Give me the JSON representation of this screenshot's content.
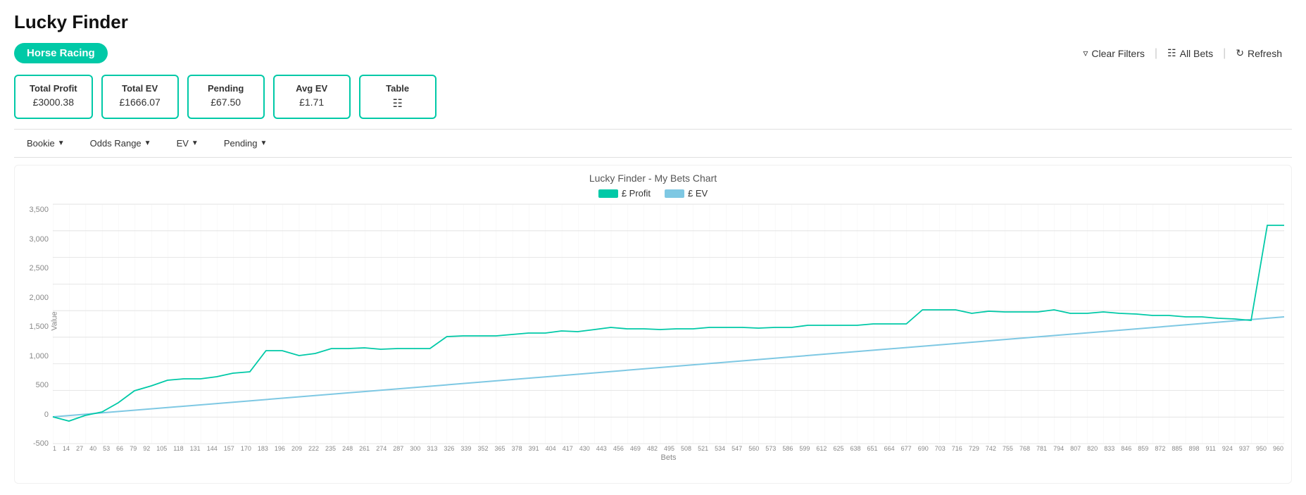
{
  "page": {
    "title": "Lucky Finder"
  },
  "header": {
    "filter_tag": "Horse Racing",
    "actions": [
      {
        "id": "clear-filters",
        "label": "Clear Filters",
        "icon": "filter"
      },
      {
        "id": "all-bets",
        "label": "All Bets",
        "icon": "table"
      },
      {
        "id": "refresh",
        "label": "Refresh",
        "icon": "refresh"
      }
    ]
  },
  "stats": [
    {
      "id": "total-profit",
      "label": "Total Profit",
      "value": "£3000.38"
    },
    {
      "id": "total-ev",
      "label": "Total EV",
      "value": "£1666.07"
    },
    {
      "id": "pending",
      "label": "Pending",
      "value": "£67.50"
    },
    {
      "id": "avg-ev",
      "label": "Avg EV",
      "value": "£1.71"
    },
    {
      "id": "table",
      "label": "Table",
      "value": "table-icon"
    }
  ],
  "filters": [
    {
      "id": "bookie",
      "label": "Bookie"
    },
    {
      "id": "odds-range",
      "label": "Odds Range"
    },
    {
      "id": "ev",
      "label": "EV"
    },
    {
      "id": "pending",
      "label": "Pending"
    }
  ],
  "chart": {
    "title": "Lucky Finder - My Bets Chart",
    "legend": [
      {
        "id": "profit",
        "label": "£ Profit",
        "color": "#00c9a7"
      },
      {
        "id": "ev",
        "label": "£ EV",
        "color": "#7ec8e3"
      }
    ],
    "y_axis_label": "Value",
    "x_axis_label": "Bets",
    "y_ticks": [
      "3,500",
      "3,000",
      "2,500",
      "2,000",
      "1,500",
      "1,000",
      "500",
      "0",
      "-500"
    ],
    "x_ticks": [
      "1",
      "14",
      "27",
      "40",
      "53",
      "66",
      "79",
      "92",
      "105",
      "118",
      "131",
      "144",
      "157",
      "170",
      "183",
      "196",
      "209",
      "222",
      "235",
      "248",
      "261",
      "274",
      "287",
      "300",
      "313",
      "326",
      "339",
      "352",
      "365",
      "378",
      "391",
      "404",
      "417",
      "430",
      "443",
      "456",
      "469",
      "482",
      "495",
      "508",
      "521",
      "534",
      "547",
      "560",
      "573",
      "586",
      "599",
      "612",
      "625",
      "638",
      "651",
      "664",
      "677",
      "690",
      "703",
      "716",
      "729",
      "742",
      "755",
      "768",
      "781",
      "794",
      "807",
      "820",
      "833",
      "846",
      "859",
      "872",
      "885",
      "898",
      "911",
      "924",
      "937",
      "950",
      "960"
    ]
  }
}
